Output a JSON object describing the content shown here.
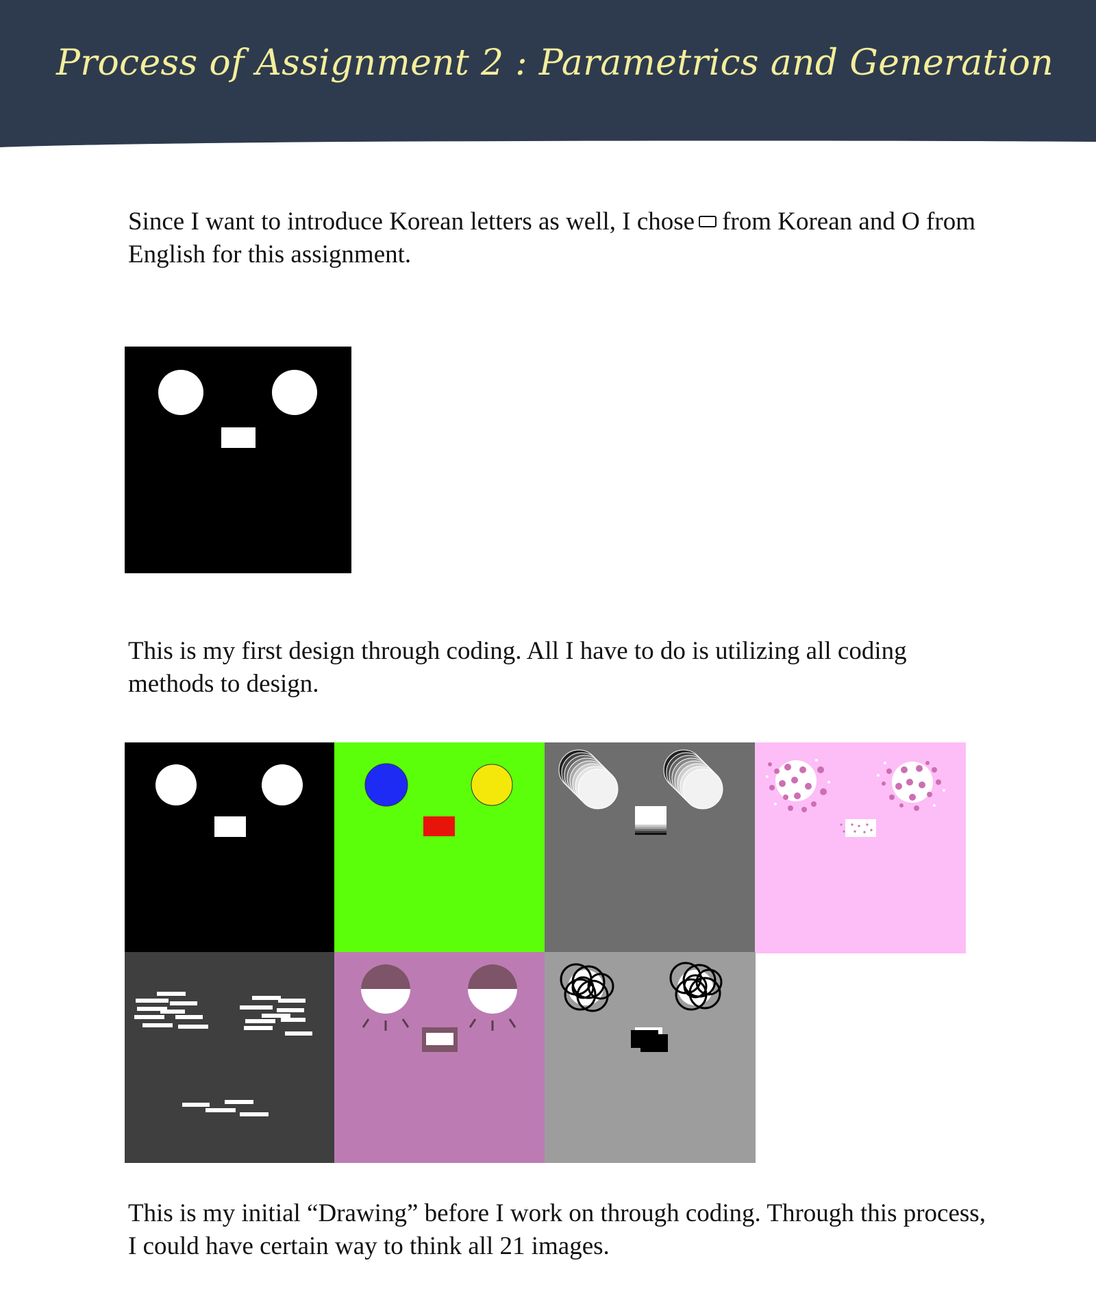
{
  "header": {
    "title": "Process of Assignment 2 : Parametrics and Generation",
    "background": "#2e3b4e",
    "title_color": "#f4ee9b"
  },
  "paragraphs": {
    "intro_before": "Since I want to introduce Korean letters as well, I chose",
    "intro_glyph": "ㅁ",
    "intro_after": "from Korean and O from English for this assignment.",
    "first_design": "This is my first design through coding.  All I have to do is utilizing all coding methods to design.",
    "initial_drawing": "This is my initial “Drawing” before I work on through coding. Through this process, I could have certain way to think all 21 images."
  },
  "figures": {
    "first_design": {
      "background": "#000000",
      "shape_color": "#ffffff"
    },
    "variations": [
      {
        "name": "black",
        "background": "#000000"
      },
      {
        "name": "green",
        "background": "#5cff0a",
        "accents": [
          "#1e2bf5",
          "#f4e80a",
          "#e8140a"
        ]
      },
      {
        "name": "gray-gradient",
        "background": "#6e6e6e"
      },
      {
        "name": "pink-dots",
        "background": "#fdbdf6",
        "accents": [
          "#cc6fb2"
        ]
      },
      {
        "name": "dark-bars",
        "background": "#3f3f3f"
      },
      {
        "name": "mauve-eyelids",
        "background": "#bc7cb3",
        "accents": [
          "#7d5468"
        ]
      },
      {
        "name": "gray-circles",
        "background": "#9d9d9d"
      }
    ]
  }
}
